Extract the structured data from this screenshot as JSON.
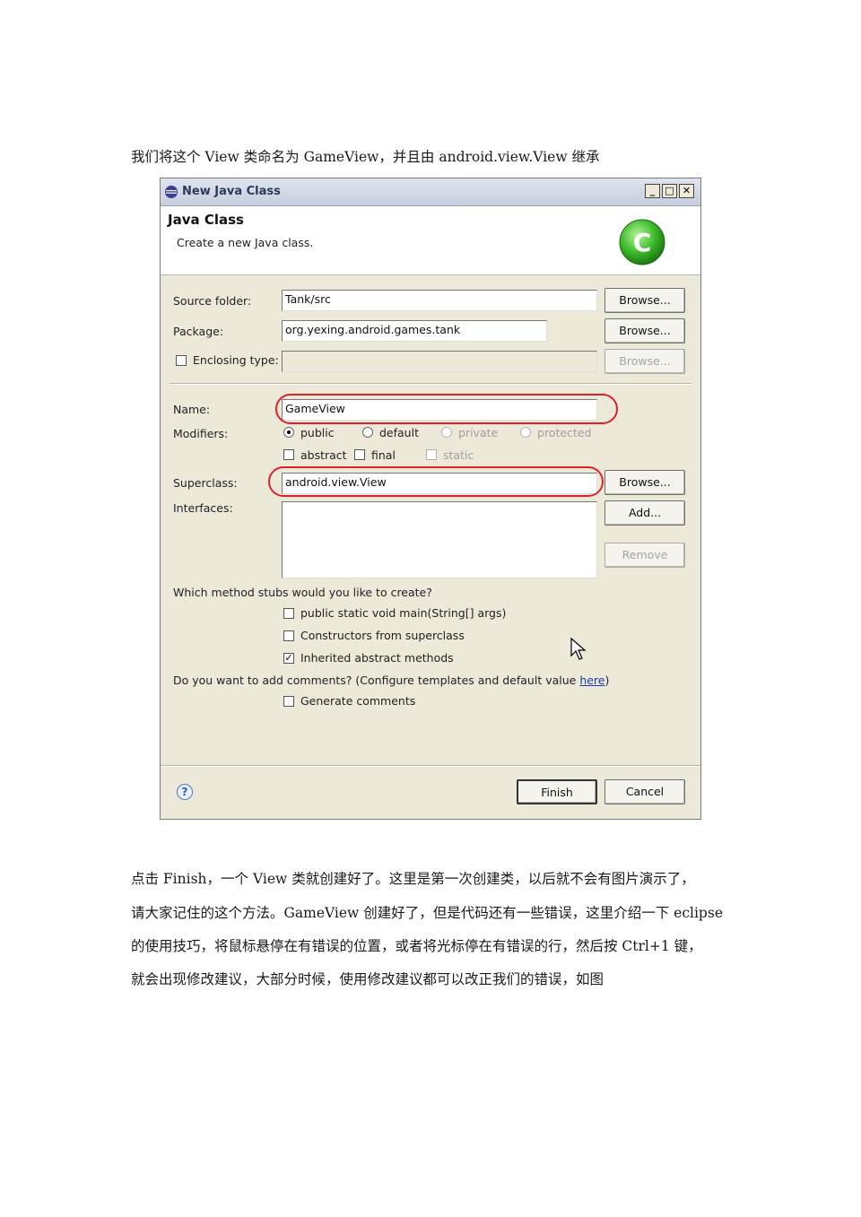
{
  "doc": {
    "intro": "我们将这个 View 类命名为 GameView，并且由 android.view.View 继承",
    "para": [
      "点击 Finish，一个 View 类就创建好了。这里是第一次创建类，以后就不会有图片演示了，",
      "请大家记住的这个方法。GameView 创建好了，但是代码还有一些错误，这里介绍一下 eclipse",
      "的使用技巧，将鼠标悬停在有错误的位置，或者将光标停在有错误的行，然后按 Ctrl+1 键，",
      "就会出现修改建议，大部分时候，使用修改建议都可以改正我们的错误，如图"
    ]
  },
  "dialog": {
    "title": "New Java Class",
    "banner_title": "Java Class",
    "banner_subtitle": "Create a new Java class.",
    "source_folder": {
      "label": "Source folder:",
      "value": "Tank/src",
      "browse": "Browse..."
    },
    "package": {
      "label": "Package:",
      "value": "org.yexing.android.games.tank",
      "browse": "Browse..."
    },
    "enclosing": {
      "label": "Enclosing type:",
      "value": "",
      "browse": "Browse...",
      "checked": false
    },
    "name": {
      "label": "Name:",
      "value": "GameView"
    },
    "modifiers": {
      "label": "Modifiers:",
      "radios": [
        {
          "label": "public",
          "selected": true,
          "enabled": true
        },
        {
          "label": "default",
          "selected": false,
          "enabled": true
        },
        {
          "label": "private",
          "selected": false,
          "enabled": false
        },
        {
          "label": "protected",
          "selected": false,
          "enabled": false
        }
      ],
      "checks": [
        {
          "label": "abstract",
          "checked": false,
          "enabled": true
        },
        {
          "label": "final",
          "checked": false,
          "enabled": true
        },
        {
          "label": "static",
          "checked": false,
          "enabled": false
        }
      ]
    },
    "superclass": {
      "label": "Superclass:",
      "value": "android.view.View",
      "browse": "Browse..."
    },
    "interfaces": {
      "label": "Interfaces:",
      "add": "Add...",
      "remove": "Remove"
    },
    "stubs": {
      "question": "Which method stubs would you like to create?",
      "options": [
        {
          "label": "public static void main(String[] args)",
          "checked": false
        },
        {
          "label": "Constructors from superclass",
          "checked": false
        },
        {
          "label": "Inherited abstract methods",
          "checked": true
        }
      ]
    },
    "comments": {
      "question": "Do you want to add comments? (Configure templates and default value ",
      "link": "here",
      "close": ")",
      "option": {
        "label": "Generate comments",
        "checked": false
      }
    },
    "finish": "Finish",
    "cancel": "Cancel",
    "colors": {
      "highlight": "#e0202a",
      "link": "#1a3ab0"
    }
  }
}
